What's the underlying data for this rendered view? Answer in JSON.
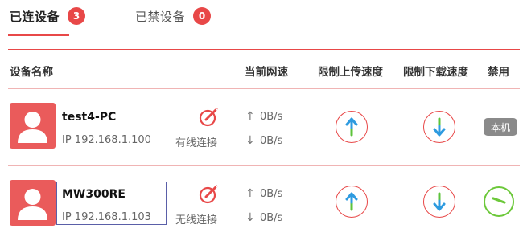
{
  "tabs": {
    "connected": {
      "label": "已连设备",
      "count": "3"
    },
    "banned": {
      "label": "已禁设备",
      "count": "0"
    }
  },
  "table": {
    "headers": {
      "device_name": "设备名称",
      "current_speed": "当前网速",
      "upload_limit": "限制上传速度",
      "download_limit": "限制下载速度",
      "ban": "禁用"
    }
  },
  "devices": [
    {
      "name": "test4-PC",
      "ip": "IP 192.168.1.100",
      "connection": "有线连接",
      "upload_speed": "0B/s",
      "download_speed": "0B/s",
      "ban_state": "本机"
    },
    {
      "name": "MW300RE",
      "ip": "IP 192.168.1.103",
      "connection": "无线连接",
      "upload_speed": "0B/s",
      "download_speed": "0B/s",
      "ban_state": ""
    }
  ],
  "colors": {
    "accent": "#e84848",
    "avatar": "#ea5b5b",
    "upload_arrow": "#2e9be0",
    "upload_arrow_tail": "#5cc33a",
    "download_arrow": "#2e9be0",
    "ban_green": "#6cc83a"
  },
  "icons": {
    "avatar": "user-silhouette-icon",
    "edit": "edit-pencil-icon",
    "up": "arrow-up-icon",
    "down": "arrow-down-icon",
    "ban": "ban-toggle-icon"
  }
}
